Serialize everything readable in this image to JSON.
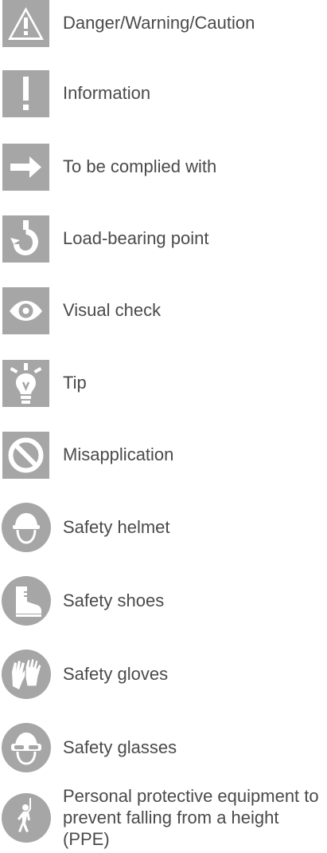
{
  "legend": {
    "items": [
      {
        "label": "Danger/Warning/Caution",
        "icon": "warning-triangle-icon"
      },
      {
        "label": "Information",
        "icon": "exclamation-icon"
      },
      {
        "label": "To be complied with",
        "icon": "arrow-right-icon"
      },
      {
        "label": "Load-bearing point",
        "icon": "hook-icon"
      },
      {
        "label": "Visual check",
        "icon": "eye-icon"
      },
      {
        "label": "Tip",
        "icon": "lightbulb-icon"
      },
      {
        "label": "Misapplication",
        "icon": "prohibited-icon"
      },
      {
        "label": "Safety helmet",
        "icon": "helmet-icon"
      },
      {
        "label": "Safety shoes",
        "icon": "boot-icon"
      },
      {
        "label": "Safety gloves",
        "icon": "gloves-icon"
      },
      {
        "label": "Safety glasses",
        "icon": "glasses-icon"
      },
      {
        "label": "Personal protective equipment to prevent falling from a height (PPE)",
        "icon": "fall-protection-icon"
      }
    ]
  },
  "colors": {
    "icon_gray": "#a6a6a6",
    "icon_fg": "#ffffff",
    "text": "#4a4a4a"
  }
}
